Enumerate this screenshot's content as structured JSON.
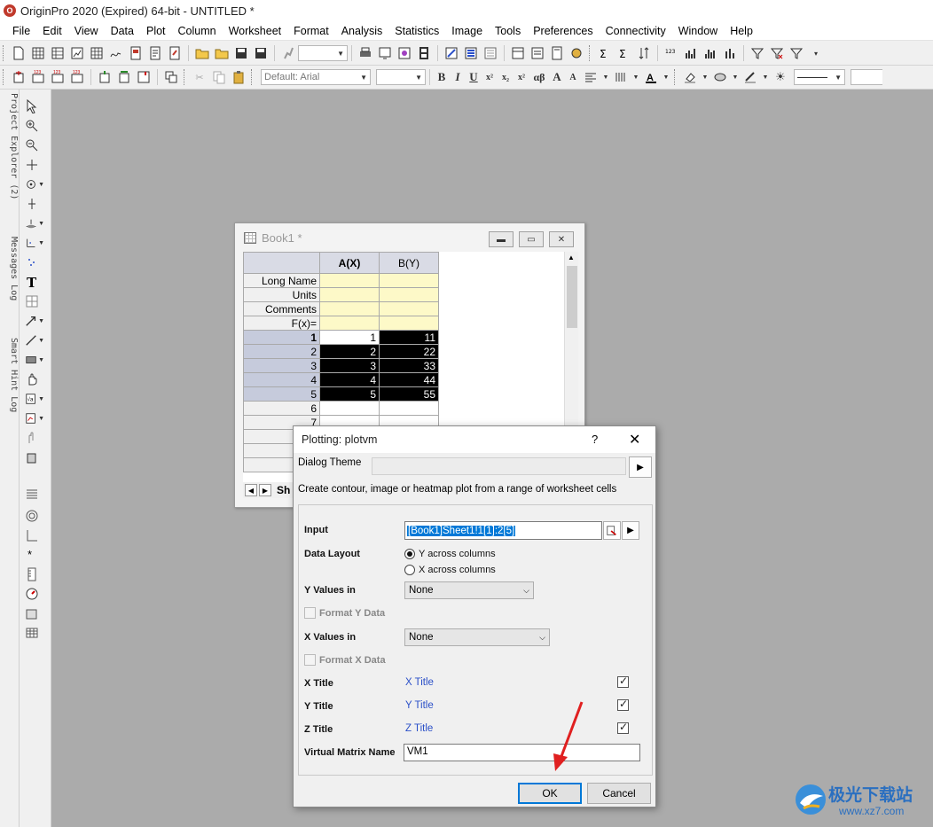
{
  "window": {
    "title": "OriginPro 2020 (Expired) 64-bit - UNTITLED *",
    "app_icon": "origin-icon"
  },
  "menu": [
    "File",
    "Edit",
    "View",
    "Data",
    "Plot",
    "Column",
    "Worksheet",
    "Format",
    "Analysis",
    "Statistics",
    "Image",
    "Tools",
    "Preferences",
    "Connectivity",
    "Window",
    "Help"
  ],
  "toolbar": {
    "font_combo": "Default: Arial"
  },
  "left_dock": {
    "tabs": [
      "Project Explorer (2)",
      "Messages Log",
      "Smart Hint Log"
    ]
  },
  "book": {
    "title": "Book1 *",
    "columns": [
      "A(X)",
      "B(Y)"
    ],
    "property_rows": [
      "Long Name",
      "Units",
      "Comments",
      "F(x)="
    ],
    "rows": [
      {
        "n": "1",
        "a": "1",
        "b": "11"
      },
      {
        "n": "2",
        "a": "2",
        "b": "22"
      },
      {
        "n": "3",
        "a": "3",
        "b": "33"
      },
      {
        "n": "4",
        "a": "4",
        "b": "44"
      },
      {
        "n": "5",
        "a": "5",
        "b": "55"
      },
      {
        "n": "6",
        "a": "",
        "b": ""
      },
      {
        "n": "7",
        "a": "",
        "b": ""
      }
    ],
    "sheet_tab": "Sh"
  },
  "dialog": {
    "title": "Plotting: plotvm",
    "help": "?",
    "close": "✕",
    "theme_label": "Dialog Theme",
    "theme_value": "",
    "description": "Create contour, image or heatmap plot from a range of worksheet cells",
    "input_label": "Input",
    "input_value": "[Book1]Sheet1!1[1]:2[5]",
    "layout_label": "Data Layout",
    "layout_options": [
      "Y across columns",
      "X across columns"
    ],
    "layout_selected": "Y across columns",
    "y_values_label": "Y Values in",
    "y_values_value": "None",
    "format_y_label": "Format Y Data",
    "x_values_label": "X Values in",
    "x_values_value": "None",
    "format_x_label": "Format X Data",
    "x_title_label": "X Title",
    "x_title_value": "X Title",
    "y_title_label": "Y Title",
    "y_title_value": "Y Title",
    "z_title_label": "Z Title",
    "z_title_value": "Z Title",
    "vm_label": "Virtual Matrix Name",
    "vm_value": "VM1",
    "ok": "OK",
    "cancel": "Cancel"
  },
  "annotation": {
    "arrow_color": "#e02020"
  },
  "watermark": {
    "text": "极光下载站",
    "url": "www.xz7.com"
  }
}
